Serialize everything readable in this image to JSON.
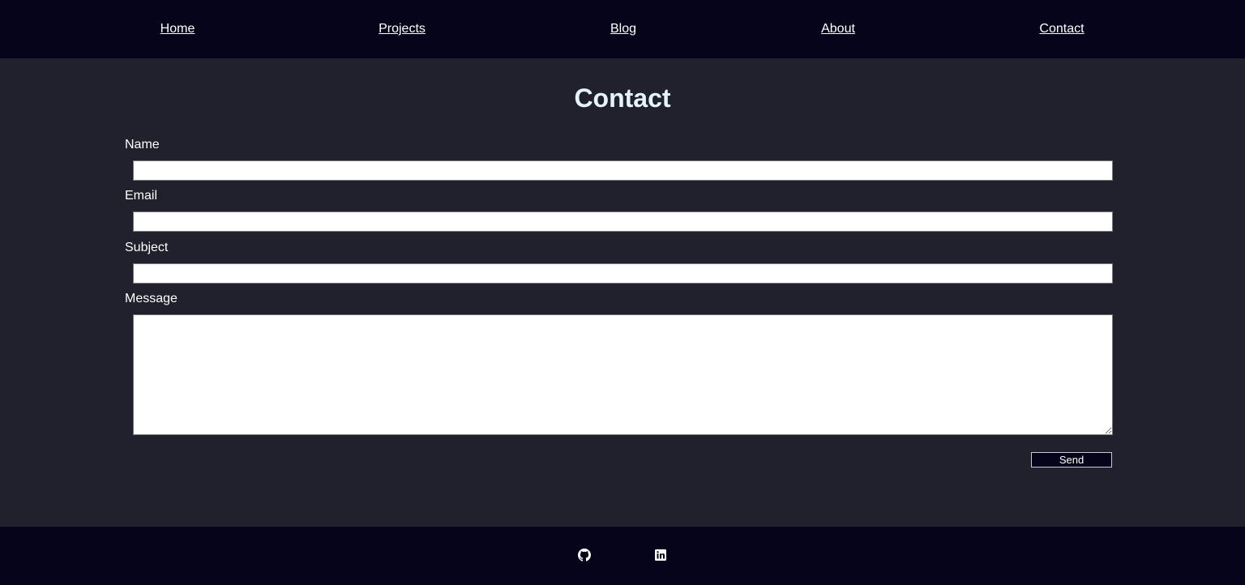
{
  "nav": {
    "items": [
      {
        "label": "Home"
      },
      {
        "label": "Projects"
      },
      {
        "label": "Blog"
      },
      {
        "label": "About"
      },
      {
        "label": "Contact"
      }
    ]
  },
  "contact": {
    "title": "Contact",
    "fields": {
      "name": {
        "label": "Name",
        "value": ""
      },
      "email": {
        "label": "Email",
        "value": ""
      },
      "subject": {
        "label": "Subject",
        "value": ""
      },
      "message": {
        "label": "Message",
        "value": ""
      }
    },
    "send_label": "Send"
  },
  "footer": {
    "links": [
      {
        "icon": "github-icon"
      },
      {
        "icon": "linkedin-icon"
      }
    ]
  },
  "colors": {
    "nav_background": "#06041a",
    "page_background": "#21202d",
    "title": "#e4f4f8",
    "text": "#ffffff"
  }
}
